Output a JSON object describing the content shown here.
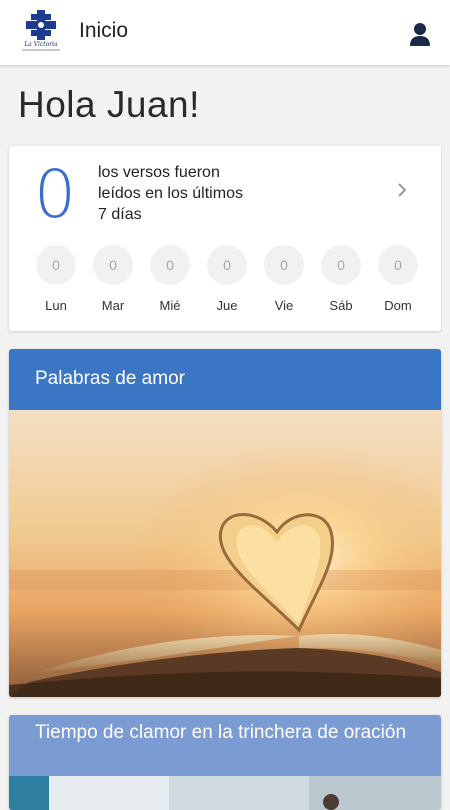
{
  "header": {
    "logo_text": "La Victoria",
    "title": "Inicio",
    "user_icon": "user-icon"
  },
  "greeting": "Hola Juan!",
  "stats": {
    "count": "0",
    "description": "los versos fueron leídos en los últimos 7 días",
    "chevron_icon": "chevron-right-icon",
    "days": [
      {
        "label": "Lun",
        "value": "0"
      },
      {
        "label": "Mar",
        "value": "0"
      },
      {
        "label": "Mié",
        "value": "0"
      },
      {
        "label": "Jue",
        "value": "0"
      },
      {
        "label": "Vie",
        "value": "0"
      },
      {
        "label": "Sáb",
        "value": "0"
      },
      {
        "label": "Dom",
        "value": "0"
      }
    ]
  },
  "articles": [
    {
      "title": "Palabras de amor",
      "image": "open-book-heart-sunset"
    },
    {
      "title": "Tiempo de clamor en la trinchera de oración",
      "image": "article-photo"
    }
  ],
  "colors": {
    "accent": "#3b6ec9",
    "article_header_1": "#3b76c4",
    "article_header_2": "#7b9bd3"
  }
}
